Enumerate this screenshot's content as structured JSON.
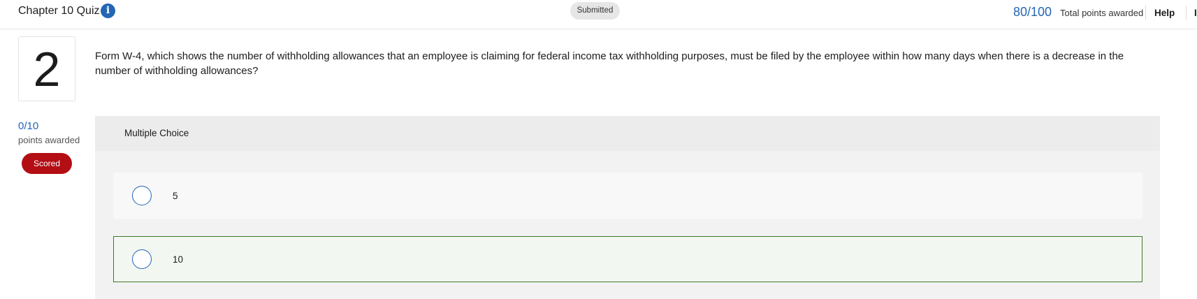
{
  "header": {
    "quiz_title": "Chapter 10 Quiz",
    "info_icon": "info-icon",
    "status": "Submitted",
    "total_score": "80/100",
    "total_score_label": "Total points awarded",
    "help_label": "Help",
    "cut_off_label": "I"
  },
  "question": {
    "number": "2",
    "text": "Form W-4, which shows the number of withholding allowances that an employee is claiming for federal income tax withholding purposes, must be filed by the employee within how many days when there is a decrease in the number of withholding allowances?",
    "points": "0/10",
    "points_label": "points awarded",
    "status_badge": "Scored"
  },
  "answer": {
    "type_label": "Multiple Choice",
    "options": [
      {
        "label": "5",
        "selected": false,
        "correct": false
      },
      {
        "label": "10",
        "selected": false,
        "correct": true
      }
    ]
  },
  "colors": {
    "accent_blue": "#2366b5",
    "scored_red": "#b30e14",
    "correct_green": "#3d7a2a"
  }
}
